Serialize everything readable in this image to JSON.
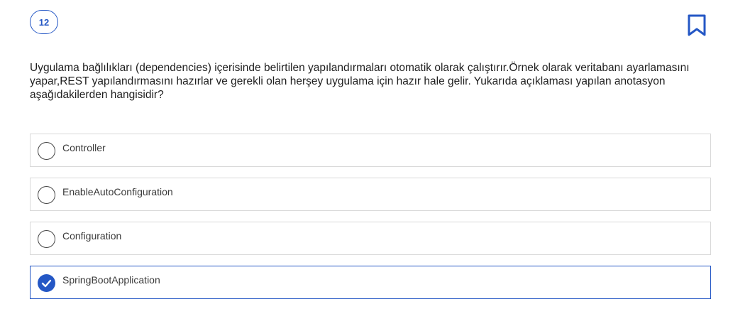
{
  "question": {
    "number": "12",
    "text": "Uygulama bağlılıkları (dependencies) içerisinde belirtilen yapılandırmaları otomatik olarak çalıştırır.Örnek olarak veritabanı ayarlamasını yapar,REST yapılandırmasını hazırlar ve gerekli olan herşey uygulama için hazır hale gelir. Yukarıda açıklaması yapılan anotasyon aşağıdakilerden hangisidir?",
    "bookmark_icon": "bookmark-icon"
  },
  "options": [
    {
      "label": "Controller",
      "selected": false
    },
    {
      "label": "EnableAutoConfiguration",
      "selected": false
    },
    {
      "label": "Configuration",
      "selected": false
    },
    {
      "label": "SpringBootApplication",
      "selected": true
    }
  ],
  "colors": {
    "accent": "#2457c5",
    "border": "#d9d9d9",
    "text": "#1f1f1f"
  }
}
